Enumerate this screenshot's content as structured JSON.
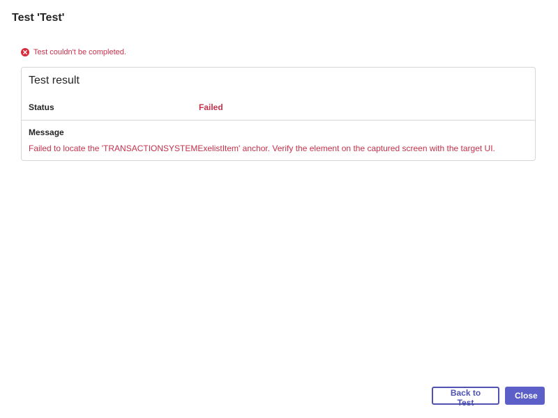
{
  "dialog": {
    "title": "Test 'Test'"
  },
  "error_banner": {
    "icon": "error-circle-icon",
    "text": "Test couldn't be completed.",
    "color": "#c4314b"
  },
  "result": {
    "title": "Test result",
    "status_label": "Status",
    "status_value": "Failed",
    "message_label": "Message",
    "message_text": "Failed to locate the 'TRANSACTIONSYSTEMExelistItem' anchor. Verify the element on the captured screen with the target UI."
  },
  "footer": {
    "back_label": "Back to Test",
    "close_label": "Close",
    "accent": "#5b5fc7"
  }
}
